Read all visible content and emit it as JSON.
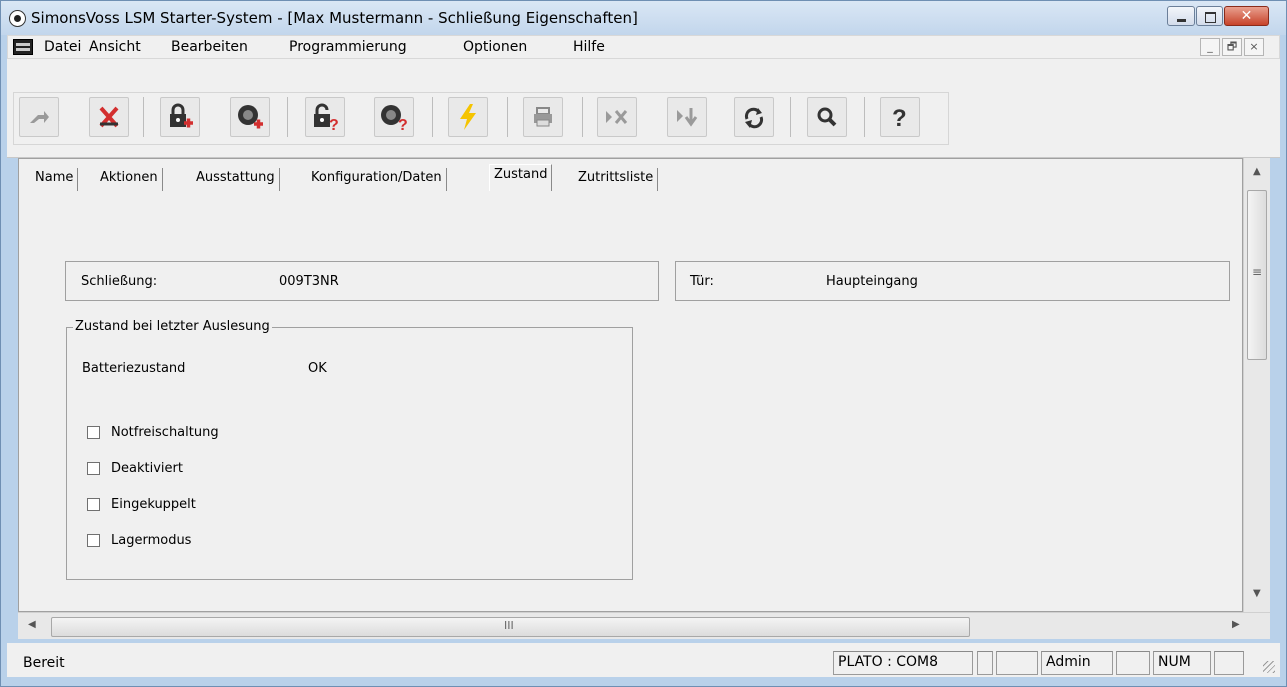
{
  "window": {
    "title": "SimonsVoss LSM Starter-System - [Max Mustermann - Schließung Eigenschaften]",
    "close_glyph": "✕"
  },
  "menu": {
    "items": [
      "Datei",
      "Ansicht",
      "Bearbeiten",
      "Programmierung",
      "Optionen",
      "Hilfe"
    ],
    "mdi_buttons": [
      "_",
      "🗗",
      "×"
    ]
  },
  "toolbar": {
    "buttons": [
      {
        "icon": "forward-arrow-icon"
      },
      {
        "icon": "delete-cross-icon",
        "color": "#d32f2f"
      },
      {
        "icon": "new-lock-icon"
      },
      {
        "icon": "new-transponder-icon"
      },
      {
        "icon": "lock-query-icon"
      },
      {
        "icon": "transponder-query-icon"
      },
      {
        "icon": "lightning-icon",
        "color": "#f5c400"
      },
      {
        "icon": "print-icon"
      },
      {
        "icon": "skip-cross-icon"
      },
      {
        "icon": "skip-down-icon"
      },
      {
        "icon": "refresh-icon"
      },
      {
        "icon": "search-icon"
      },
      {
        "icon": "help-icon"
      }
    ]
  },
  "tabs": [
    "Name",
    "Aktionen",
    "Ausstattung",
    "Konfiguration/Daten",
    "Zustand",
    "Zutrittsliste"
  ],
  "active_tab": "Zustand",
  "details": {
    "lock_label": "Schließung:",
    "lock_value": "009T3NR",
    "door_label": "Tür:",
    "door_value": "Haupteingang"
  },
  "status_group": {
    "legend": "Zustand bei letzter Auslesung",
    "battery_label": "Batteriezustand",
    "battery_value": "OK",
    "checkboxes": [
      {
        "label": "Notfreischaltung",
        "checked": false
      },
      {
        "label": "Deaktiviert",
        "checked": false
      },
      {
        "label": "Eingekuppelt",
        "checked": false
      },
      {
        "label": "Lagermodus",
        "checked": false
      }
    ]
  },
  "hscroll_grip": "III",
  "vscroll_grip": "≡",
  "statusbar": {
    "text": "Bereit",
    "port": "PLATO : COM8",
    "user": "Admin",
    "numlock": "NUM"
  }
}
